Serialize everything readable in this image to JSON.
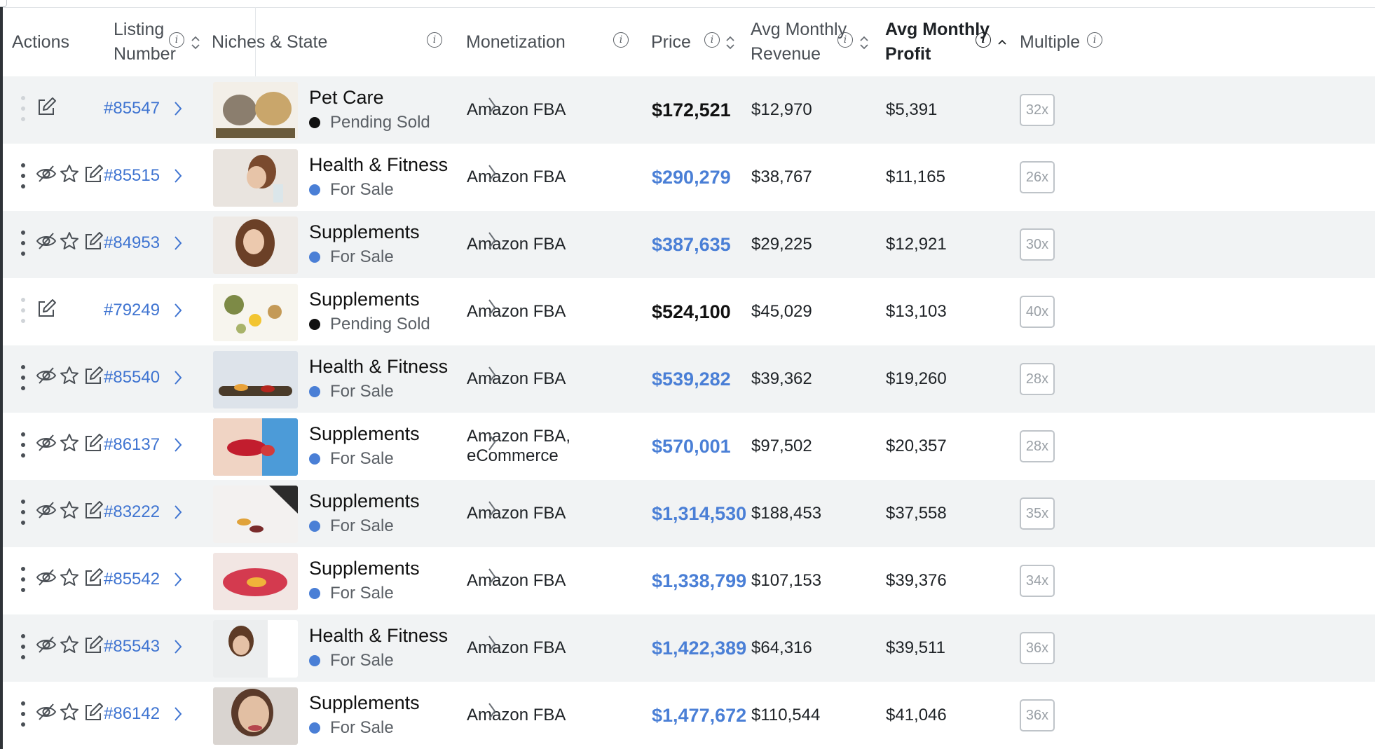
{
  "columns": {
    "actions": "Actions",
    "listing_number": [
      "Listing",
      "Number"
    ],
    "niches_state": "Niches & State",
    "monetization": "Monetization",
    "price": "Price",
    "avg_monthly_revenue": [
      "Avg Monthly",
      "Revenue"
    ],
    "avg_monthly_profit": [
      "Avg Monthly",
      "Profit"
    ],
    "multiple": "Multiple"
  },
  "icons": {
    "info": "info-icon",
    "sort": "sort-updown-icon",
    "sort_active": "sort-up-icon",
    "kebab": "kebab-menu-icon",
    "hide": "eye-slash-icon",
    "favorite": "star-icon",
    "edit": "edit-icon",
    "chevron": "chevron-right-icon"
  },
  "colors": {
    "link": "#3f74d1",
    "price_for_sale": "#4a7fd6",
    "status_for_sale": "#4a7fd6",
    "status_pending": "#111111",
    "row_alt": "#f1f3f4"
  },
  "rows": [
    {
      "listing": "#85547",
      "niche": "Pet Care",
      "state": "Pending Sold",
      "state_kind": "pending",
      "monetization": "Amazon FBA",
      "price": "$172,521",
      "revenue": "$12,970",
      "profit": "$5,391",
      "multiple": "32x",
      "limited_actions": true
    },
    {
      "listing": "#85515",
      "niche": "Health & Fitness",
      "state": "For Sale",
      "state_kind": "sale",
      "monetization": "Amazon FBA",
      "price": "$290,279",
      "revenue": "$38,767",
      "profit": "$11,165",
      "multiple": "26x",
      "limited_actions": false
    },
    {
      "listing": "#84953",
      "niche": "Supplements",
      "state": "For Sale",
      "state_kind": "sale",
      "monetization": "Amazon FBA",
      "price": "$387,635",
      "revenue": "$29,225",
      "profit": "$12,921",
      "multiple": "30x",
      "limited_actions": false
    },
    {
      "listing": "#79249",
      "niche": "Supplements",
      "state": "Pending Sold",
      "state_kind": "pending",
      "monetization": "Amazon FBA",
      "price": "$524,100",
      "revenue": "$45,029",
      "profit": "$13,103",
      "multiple": "40x",
      "limited_actions": true
    },
    {
      "listing": "#85540",
      "niche": "Health & Fitness",
      "state": "For Sale",
      "state_kind": "sale",
      "monetization": "Amazon FBA",
      "price": "$539,282",
      "revenue": "$39,362",
      "profit": "$19,260",
      "multiple": "28x",
      "limited_actions": false
    },
    {
      "listing": "#86137",
      "niche": "Supplements",
      "state": "For Sale",
      "state_kind": "sale",
      "monetization": "Amazon FBA, eCommerce",
      "price": "$570,001",
      "revenue": "$97,502",
      "profit": "$20,357",
      "multiple": "28x",
      "limited_actions": false
    },
    {
      "listing": "#83222",
      "niche": "Supplements",
      "state": "For Sale",
      "state_kind": "sale",
      "monetization": "Amazon FBA",
      "price": "$1,314,530",
      "revenue": "$188,453",
      "profit": "$37,558",
      "multiple": "35x",
      "limited_actions": false
    },
    {
      "listing": "#85542",
      "niche": "Supplements",
      "state": "For Sale",
      "state_kind": "sale",
      "monetization": "Amazon FBA",
      "price": "$1,338,799",
      "revenue": "$107,153",
      "profit": "$39,376",
      "multiple": "34x",
      "limited_actions": false
    },
    {
      "listing": "#85543",
      "niche": "Health & Fitness",
      "state": "For Sale",
      "state_kind": "sale",
      "monetization": "Amazon FBA",
      "price": "$1,422,389",
      "revenue": "$64,316",
      "profit": "$39,511",
      "multiple": "36x",
      "limited_actions": false
    },
    {
      "listing": "#86142",
      "niche": "Supplements",
      "state": "For Sale",
      "state_kind": "sale",
      "monetization": "Amazon FBA",
      "price": "$1,477,672",
      "revenue": "$110,544",
      "profit": "$41,046",
      "multiple": "36x",
      "limited_actions": false
    }
  ]
}
